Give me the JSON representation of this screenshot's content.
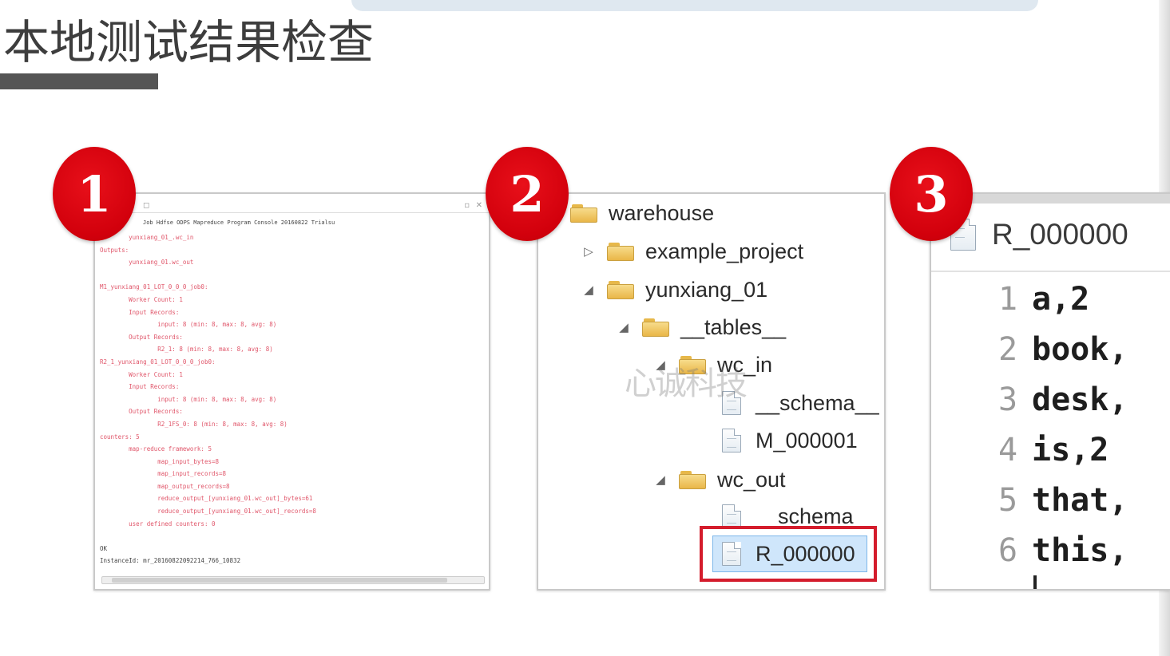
{
  "slide": {
    "title": "本地测试结果检查"
  },
  "badges": [
    "1",
    "2",
    "3"
  ],
  "console_panel": {
    "header": "Job Hdfse ODPS Mapreduce Program Console 20160822 Trialsu",
    "lines": [
      "        yunxiang_01_.wc_in",
      "Outputs:",
      "        yunxiang_01.wc_out",
      "",
      "M1_yunxiang_01_LOT_0_0_0_job0:",
      "        Worker Count: 1",
      "        Input Records:",
      "                input: 8 (min: 8, max: 8, avg: 8)",
      "        Output Records:",
      "                R2_1: 8 (min: 8, max: 8, avg: 8)",
      "R2_1_yunxiang_01_LOT_0_0_0_job0:",
      "        Worker Count: 1",
      "        Input Records:",
      "                input: 8 (min: 8, max: 8, avg: 8)",
      "        Output Records:",
      "                R2_1FS_0: 8 (min: 8, max: 8, avg: 8)",
      "counters: 5",
      "        map-reduce framework: 5",
      "                map_input_bytes=8",
      "                map_input_records=8",
      "                map_output_records=8",
      "                reduce_output_[yunxiang_01.wc_out]_bytes=61",
      "                reduce_output_[yunxiang_01.wc_out]_records=8",
      "        user defined counters: 0",
      "",
      "OK",
      "InstanceId: mr_20160822092214_766_10832"
    ]
  },
  "tree_panel": {
    "root": "warehouse",
    "items": [
      {
        "label": "example_project"
      },
      {
        "label": "yunxiang_01"
      },
      {
        "label": "__tables__"
      },
      {
        "label": "wc_in"
      },
      {
        "label": "__schema__"
      },
      {
        "label": "M_000001"
      },
      {
        "label": "wc_out"
      },
      {
        "label": "schema"
      },
      {
        "label": "R_000000"
      }
    ],
    "watermark": "心诚科技"
  },
  "file_panel": {
    "tab_label": "R_000000",
    "lines": [
      {
        "num": "1",
        "text": "a,2"
      },
      {
        "num": "2",
        "text": "book,"
      },
      {
        "num": "3",
        "text": "desk,"
      },
      {
        "num": "4",
        "text": "is,2"
      },
      {
        "num": "5",
        "text": "that,"
      },
      {
        "num": "6",
        "text": "this,"
      }
    ]
  }
}
